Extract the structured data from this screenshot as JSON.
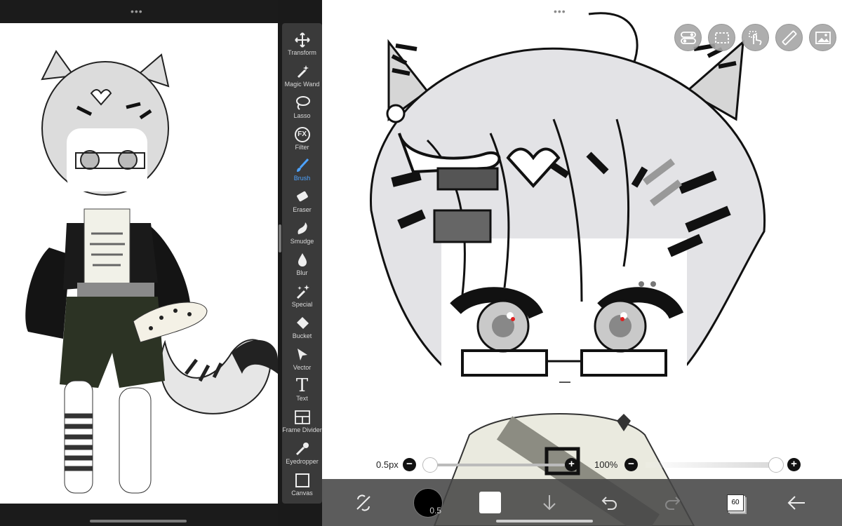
{
  "left_pane": {
    "handle": "•••"
  },
  "tools": [
    {
      "key": "transform",
      "label": "Transform",
      "icon": "move-arrows-icon"
    },
    {
      "key": "magic-wand",
      "label": "Magic Wand",
      "icon": "magic-wand-icon"
    },
    {
      "key": "lasso",
      "label": "Lasso",
      "icon": "lasso-icon"
    },
    {
      "key": "filter",
      "label": "Filter",
      "icon": "fx-icon",
      "glyph": "FX"
    },
    {
      "key": "brush",
      "label": "Brush",
      "icon": "brush-icon",
      "active": true
    },
    {
      "key": "eraser",
      "label": "Eraser",
      "icon": "eraser-icon"
    },
    {
      "key": "smudge",
      "label": "Smudge",
      "icon": "smudge-icon"
    },
    {
      "key": "blur",
      "label": "Blur",
      "icon": "drop-icon"
    },
    {
      "key": "special",
      "label": "Special",
      "icon": "sparkle-wand-icon"
    },
    {
      "key": "bucket",
      "label": "Bucket",
      "icon": "bucket-icon"
    },
    {
      "key": "vector",
      "label": "Vector",
      "icon": "cursor-arrow-icon"
    },
    {
      "key": "text",
      "label": "Text",
      "icon": "text-icon",
      "glyph": "T"
    },
    {
      "key": "frame-divider",
      "label": "Frame Divider",
      "icon": "frame-divider-icon"
    },
    {
      "key": "eyedropper",
      "label": "Eyedropper",
      "icon": "eyedropper-icon"
    },
    {
      "key": "canvas",
      "label": "Canvas",
      "icon": "canvas-icon"
    }
  ],
  "main": {
    "handle": "•••",
    "top_icons": [
      "toggle-icon",
      "selection-icon",
      "touch-icon",
      "ruler-icon",
      "image-icon"
    ],
    "brush_size": {
      "label": "0.5px",
      "value": 0.5
    },
    "opacity": {
      "label": "100%",
      "value": 100
    },
    "bottom_bar": {
      "brush_size_badge": "0.5",
      "layer_count": "60",
      "primary_color": "#000000",
      "secondary_color": "#FFFFFF"
    }
  },
  "colors": {
    "accent": "#4DA3FF",
    "rail": "#3A3A3A",
    "bottom_bar": "#464646"
  }
}
